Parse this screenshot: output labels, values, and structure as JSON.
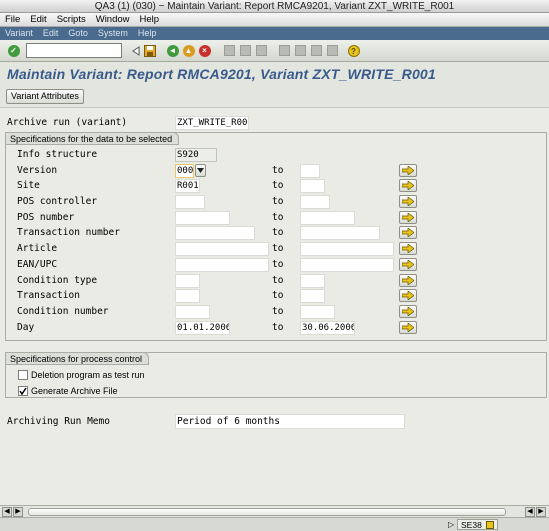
{
  "window": {
    "title": "QA3 (1) (030) − Maintain Variant: Report RMCA9201, Variant ZXT_WRITE_R001"
  },
  "menubar": [
    "File",
    "Edit",
    "Scripts",
    "Window",
    "Help"
  ],
  "sap_menu": [
    "Variant",
    "Edit",
    "Goto",
    "System",
    "Help"
  ],
  "toolbar": {
    "command_field_value": ""
  },
  "screen_title": "Maintain Variant: Report RMCA9201, Variant ZXT_WRITE_R001",
  "app_toolbar": {
    "variant_attributes_label": "Variant Attributes"
  },
  "archive_run": {
    "label": "Archive run (variant)",
    "value": "ZXT_WRITE_R001"
  },
  "spec_group": {
    "title": "Specifications for the data to be selected",
    "to_label": "to",
    "rows": [
      {
        "label": "Info structure",
        "from": "S920"
      },
      {
        "label": "Version",
        "from": "000",
        "to": ""
      },
      {
        "label": "Site",
        "from": "R001",
        "to": ""
      },
      {
        "label": "POS controller",
        "from": "",
        "to": ""
      },
      {
        "label": "POS number",
        "from": "",
        "to": ""
      },
      {
        "label": "Transaction number",
        "from": "",
        "to": ""
      },
      {
        "label": "Article",
        "from": "",
        "to": ""
      },
      {
        "label": "EAN/UPC",
        "from": "",
        "to": ""
      },
      {
        "label": "Condition type",
        "from": "",
        "to": ""
      },
      {
        "label": "Transaction",
        "from": "",
        "to": ""
      },
      {
        "label": "Condition number",
        "from": "",
        "to": ""
      },
      {
        "label": "Day",
        "from": "01.01.2006",
        "to": "30.06.2006"
      }
    ]
  },
  "process_group": {
    "title": "Specifications for process control",
    "deletion_test": {
      "label": "Deletion program as test run",
      "checked": false
    },
    "generate_file": {
      "label": "Generate Archive File",
      "checked": true
    }
  },
  "memo": {
    "label": "Archiving Run Memo",
    "value": "Period of 6 months"
  },
  "status": {
    "system": "SE38"
  }
}
